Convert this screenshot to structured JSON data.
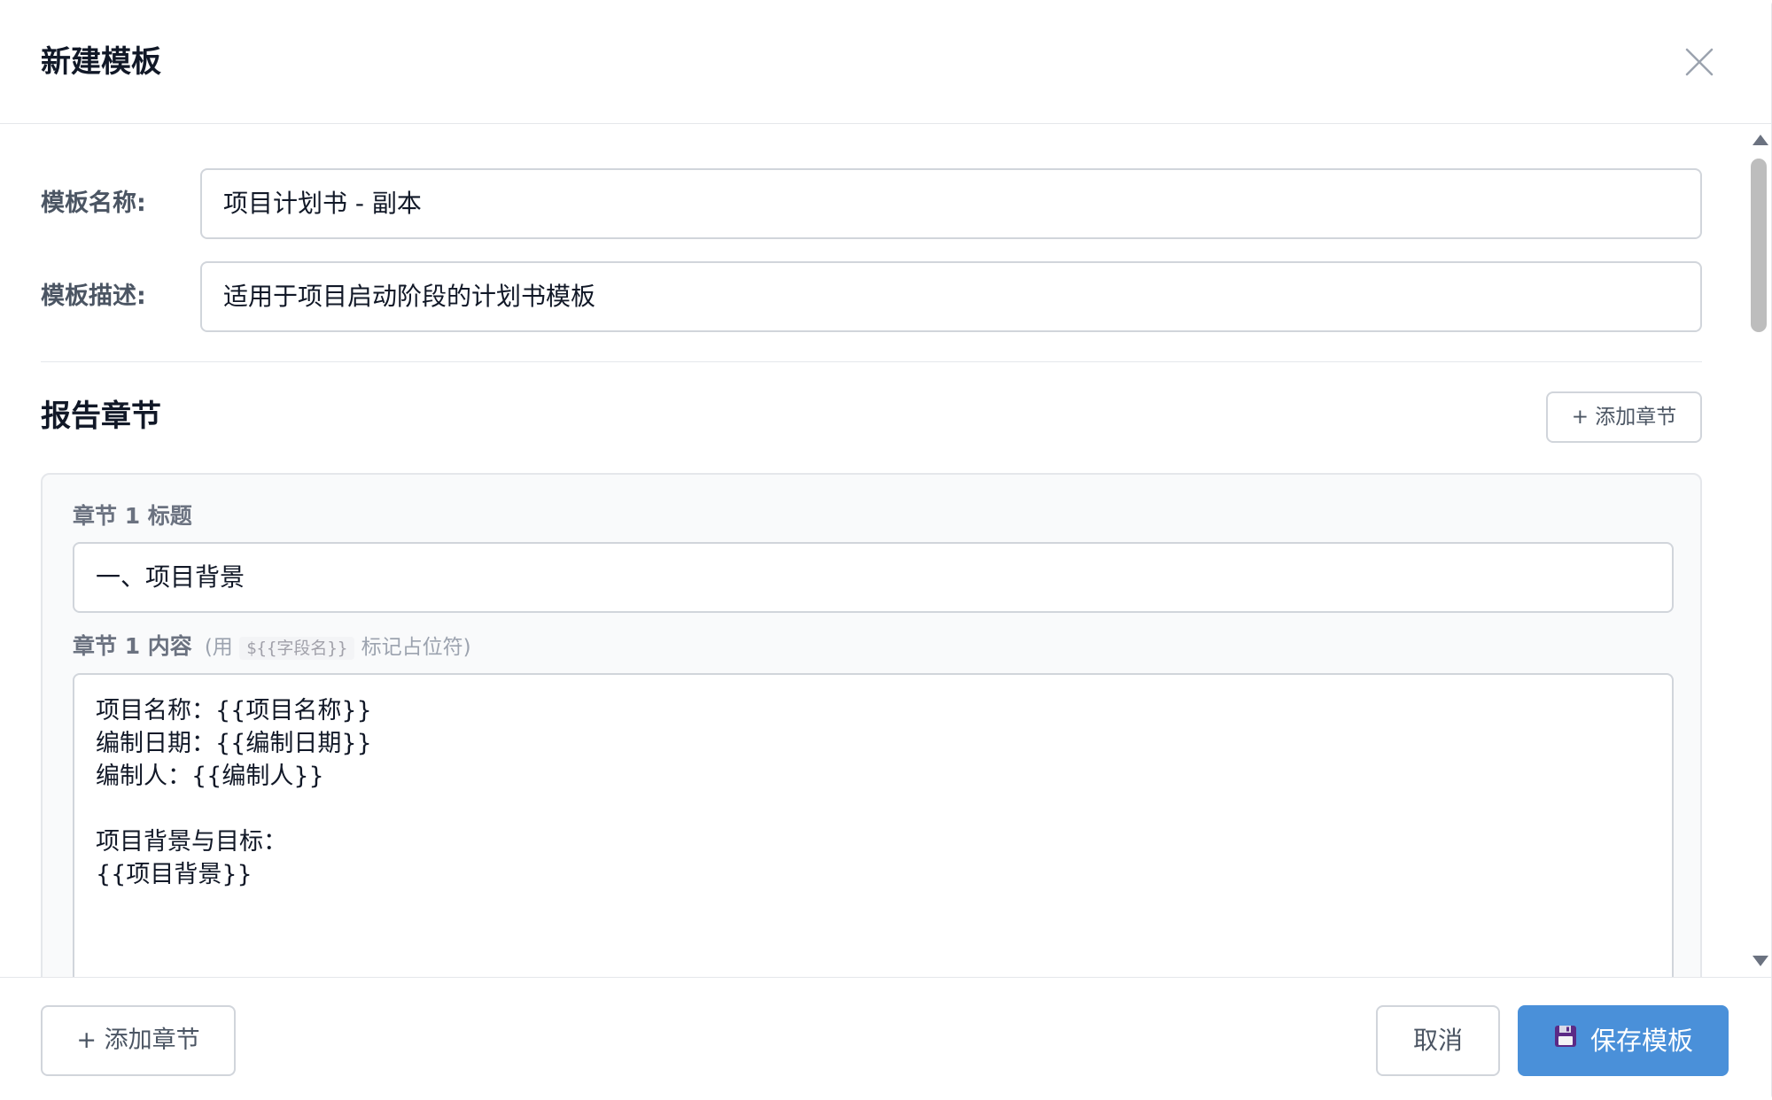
{
  "dialog": {
    "title": "新建模板",
    "close_icon": "close-icon"
  },
  "form": {
    "name_label": "模板名称:",
    "name_value": "项目计划书 - 副本",
    "desc_label": "模板描述:",
    "desc_value": "适用于项目启动阶段的计划书模板"
  },
  "sections": {
    "title": "报告章节",
    "add_button": "+ 添加章节",
    "chapters": [
      {
        "title_label": "章节 1 标题",
        "title_value": "一、项目背景",
        "content_label": "章节 1 内容",
        "hint_prefix": "(用",
        "hint_code": "${{字段名}}",
        "hint_suffix": "标记占位符)",
        "content_value": "项目名称：{{项目名称}}\n编制日期：{{编制日期}}\n编制人：{{编制人}}\n\n项目背景与目标：\n{{项目背景}}"
      }
    ]
  },
  "footer": {
    "add_button": "+ 添加章节",
    "cancel_button": "取消",
    "save_button": "保存模板",
    "save_icon": "floppy-disk-icon",
    "save_color": "#4a90d9"
  }
}
